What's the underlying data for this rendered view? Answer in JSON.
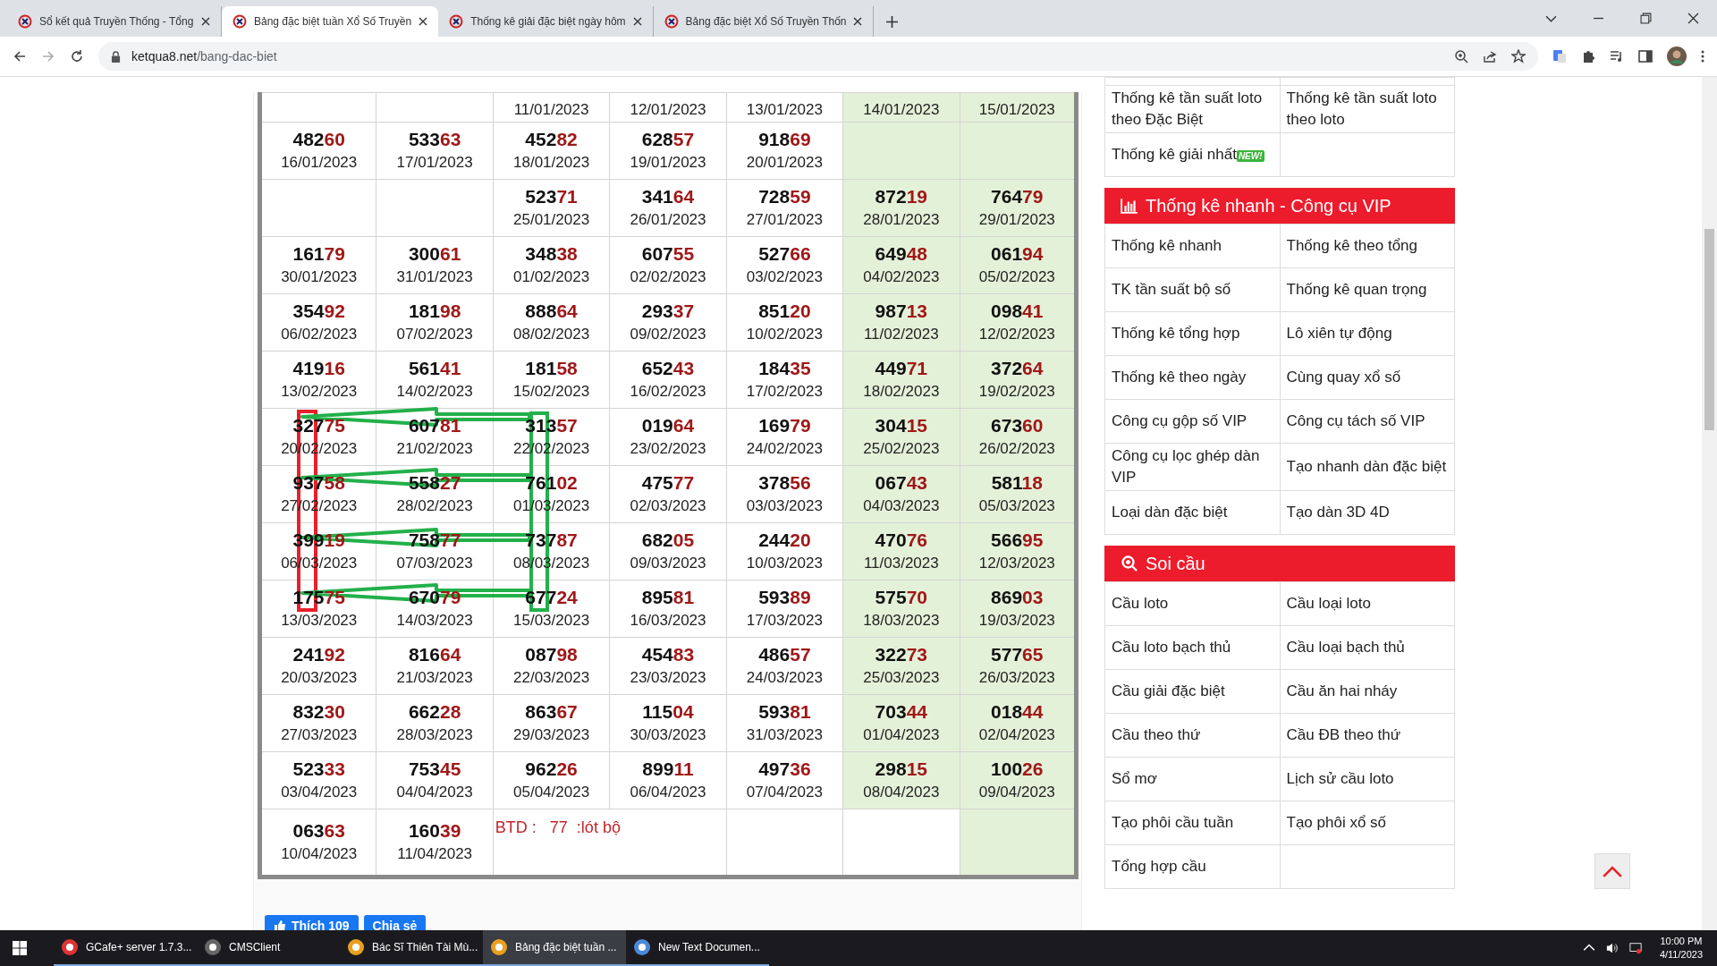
{
  "browser": {
    "tabs": [
      {
        "title": "Sổ kết quả Truyền Thống - Tổng",
        "selected": false
      },
      {
        "title": "Bảng đặc biệt tuần Xổ Số Truyền",
        "selected": true
      },
      {
        "title": "Thống kê giải đặc biệt ngày hôm",
        "selected": false
      },
      {
        "title": "Bảng đặc biệt Xổ Số Truyền Thốn",
        "selected": false
      }
    ],
    "url_host": "ketqua8.net",
    "url_path": "/bang-dac-biet"
  },
  "table": {
    "rows": [
      [
        null,
        null,
        {
          "date": "11/01/2023"
        },
        {
          "date": "12/01/2023"
        },
        {
          "date": "13/01/2023"
        },
        {
          "date": "14/01/2023"
        },
        {
          "date": "15/01/2023"
        }
      ],
      [
        {
          "number": "48260",
          "date": "16/01/2023"
        },
        {
          "number": "53363",
          "date": "17/01/2023"
        },
        {
          "number": "45282",
          "date": "18/01/2023"
        },
        {
          "number": "62857",
          "date": "19/01/2023"
        },
        {
          "number": "91869",
          "date": "20/01/2023"
        },
        null,
        null
      ],
      [
        null,
        null,
        {
          "number": "52371",
          "date": "25/01/2023"
        },
        {
          "number": "34164",
          "date": "26/01/2023"
        },
        {
          "number": "72859",
          "date": "27/01/2023"
        },
        {
          "number": "87219",
          "date": "28/01/2023"
        },
        {
          "number": "76479",
          "date": "29/01/2023"
        }
      ],
      [
        {
          "number": "16179",
          "date": "30/01/2023"
        },
        {
          "number": "30061",
          "date": "31/01/2023"
        },
        {
          "number": "34838",
          "date": "01/02/2023"
        },
        {
          "number": "60755",
          "date": "02/02/2023"
        },
        {
          "number": "52766",
          "date": "03/02/2023"
        },
        {
          "number": "64948",
          "date": "04/02/2023"
        },
        {
          "number": "06194",
          "date": "05/02/2023"
        }
      ],
      [
        {
          "number": "35492",
          "date": "06/02/2023"
        },
        {
          "number": "18198",
          "date": "07/02/2023"
        },
        {
          "number": "88864",
          "date": "08/02/2023"
        },
        {
          "number": "29337",
          "date": "09/02/2023"
        },
        {
          "number": "85120",
          "date": "10/02/2023"
        },
        {
          "number": "98713",
          "date": "11/02/2023"
        },
        {
          "number": "09841",
          "date": "12/02/2023"
        }
      ],
      [
        {
          "number": "41916",
          "date": "13/02/2023"
        },
        {
          "number": "56141",
          "date": "14/02/2023"
        },
        {
          "number": "18158",
          "date": "15/02/2023"
        },
        {
          "number": "65243",
          "date": "16/02/2023"
        },
        {
          "number": "18435",
          "date": "17/02/2023"
        },
        {
          "number": "44971",
          "date": "18/02/2023"
        },
        {
          "number": "37264",
          "date": "19/02/2023"
        }
      ],
      [
        {
          "number": "32775",
          "date": "20/02/2023"
        },
        {
          "number": "60781",
          "date": "21/02/2023"
        },
        {
          "number": "31357",
          "date": "22/02/2023"
        },
        {
          "number": "01964",
          "date": "23/02/2023"
        },
        {
          "number": "16979",
          "date": "24/02/2023"
        },
        {
          "number": "30415",
          "date": "25/02/2023"
        },
        {
          "number": "67360",
          "date": "26/02/2023"
        }
      ],
      [
        {
          "number": "93758",
          "date": "27/02/2023"
        },
        {
          "number": "55827",
          "date": "28/02/2023"
        },
        {
          "number": "76102",
          "date": "01/03/2023"
        },
        {
          "number": "47577",
          "date": "02/03/2023"
        },
        {
          "number": "37856",
          "date": "03/03/2023"
        },
        {
          "number": "06743",
          "date": "04/03/2023"
        },
        {
          "number": "58118",
          "date": "05/03/2023"
        }
      ],
      [
        {
          "number": "39919",
          "date": "06/03/2023"
        },
        {
          "number": "75877",
          "date": "07/03/2023"
        },
        {
          "number": "73787",
          "date": "08/03/2023"
        },
        {
          "number": "68205",
          "date": "09/03/2023"
        },
        {
          "number": "24420",
          "date": "10/03/2023"
        },
        {
          "number": "47076",
          "date": "11/03/2023"
        },
        {
          "number": "56695",
          "date": "12/03/2023"
        }
      ],
      [
        {
          "number": "17575",
          "date": "13/03/2023"
        },
        {
          "number": "67079",
          "date": "14/03/2023"
        },
        {
          "number": "67724",
          "date": "15/03/2023"
        },
        {
          "number": "89581",
          "date": "16/03/2023"
        },
        {
          "number": "59389",
          "date": "17/03/2023"
        },
        {
          "number": "57570",
          "date": "18/03/2023"
        },
        {
          "number": "86903",
          "date": "19/03/2023"
        }
      ],
      [
        {
          "number": "24192",
          "date": "20/03/2023"
        },
        {
          "number": "81664",
          "date": "21/03/2023"
        },
        {
          "number": "08798",
          "date": "22/03/2023"
        },
        {
          "number": "45483",
          "date": "23/03/2023"
        },
        {
          "number": "48657",
          "date": "24/03/2023"
        },
        {
          "number": "32273",
          "date": "25/03/2023"
        },
        {
          "number": "57765",
          "date": "26/03/2023"
        }
      ],
      [
        {
          "number": "83230",
          "date": "27/03/2023"
        },
        {
          "number": "66228",
          "date": "28/03/2023"
        },
        {
          "number": "86367",
          "date": "29/03/2023"
        },
        {
          "number": "11504",
          "date": "30/03/2023"
        },
        {
          "number": "59381",
          "date": "31/03/2023"
        },
        {
          "number": "70344",
          "date": "01/04/2023"
        },
        {
          "number": "01844",
          "date": "02/04/2023"
        }
      ],
      [
        {
          "number": "52333",
          "date": "03/04/2023"
        },
        {
          "number": "75345",
          "date": "04/04/2023"
        },
        {
          "number": "96226",
          "date": "05/04/2023"
        },
        {
          "number": "89911",
          "date": "06/04/2023"
        },
        {
          "number": "49736",
          "date": "07/04/2023"
        },
        {
          "number": "29815",
          "date": "08/04/2023"
        },
        {
          "number": "10026",
          "date": "09/04/2023"
        }
      ],
      [
        {
          "number": "06363",
          "date": "10/04/2023"
        },
        {
          "number": "16039",
          "date": "11/04/2023"
        },
        {
          "kind": "note",
          "text": "BTD :   77  :lót bộ",
          "colspan": 2
        },
        null,
        null,
        null
      ]
    ]
  },
  "social": {
    "like": "Thích 109",
    "share": "Chia sẻ"
  },
  "sidebar": [
    {
      "rows": [
        [
          null,
          null
        ],
        [
          {
            "text": "Thống kê tần suất loto theo Đặc Biệt"
          },
          {
            "text": "Thống kê tần suất loto theo loto"
          }
        ],
        [
          {
            "text": "Thống kê giải nhất",
            "badge": "NEW!"
          },
          null
        ]
      ]
    },
    {
      "title": "Thống kê nhanh - Công cụ VIP",
      "rows": [
        [
          {
            "text": "Thống kê nhanh"
          },
          {
            "text": "Thống kê theo tổng"
          }
        ],
        [
          {
            "text": "TK tần suất bộ số"
          },
          {
            "text": "Thống kê quan trọng"
          }
        ],
        [
          {
            "text": "Thống kê tổng hợp"
          },
          {
            "text": "Lô xiên tự động"
          }
        ],
        [
          {
            "text": "Thống kê theo ngày"
          },
          {
            "text": "Cùng quay xổ số"
          }
        ],
        [
          {
            "text": "Công cụ gộp số VIP"
          },
          {
            "text": "Công cụ tách số VIP"
          }
        ],
        [
          {
            "text": "Công cụ lọc ghép dàn VIP"
          },
          {
            "text": "Tạo nhanh dàn đặc biệt"
          }
        ],
        [
          {
            "text": "Loại dàn đặc biệt"
          },
          {
            "text": "Tạo dàn 3D 4D"
          }
        ]
      ]
    },
    {
      "title": "Soi cầu",
      "rows": [
        [
          {
            "text": "Cầu loto"
          },
          {
            "text": "Cầu loại loto"
          }
        ],
        [
          {
            "text": "Cầu loto bạch thủ"
          },
          {
            "text": "Cầu loại bạch thủ"
          }
        ],
        [
          {
            "text": "Cầu giải đặc biệt"
          },
          {
            "text": "Cầu ăn hai nháy"
          }
        ],
        [
          {
            "text": "Cầu theo thứ"
          },
          {
            "text": "Cầu ĐB theo thứ"
          }
        ],
        [
          {
            "text": "Sổ mơ"
          },
          {
            "text": "Lịch sử cầu loto"
          }
        ],
        [
          {
            "text": "Tạo phôi cầu tuần"
          },
          {
            "text": "Tạo phôi xổ số"
          }
        ],
        [
          {
            "text": "Tổng hợp cầu"
          },
          null
        ]
      ]
    }
  ],
  "taskbar": {
    "items": [
      {
        "label": "GCafe+ server 1.7.3...",
        "selected": false
      },
      {
        "label": "CMSClient",
        "selected": false
      },
      {
        "label": "Bác Sĩ Thiên Tài Mù...",
        "selected": false
      },
      {
        "label": "Bảng đặc biệt tuần ...",
        "selected": true
      },
      {
        "label": "New Text Documen...",
        "selected": false
      }
    ],
    "time": "10:00 PM",
    "date": "4/11/2023"
  }
}
